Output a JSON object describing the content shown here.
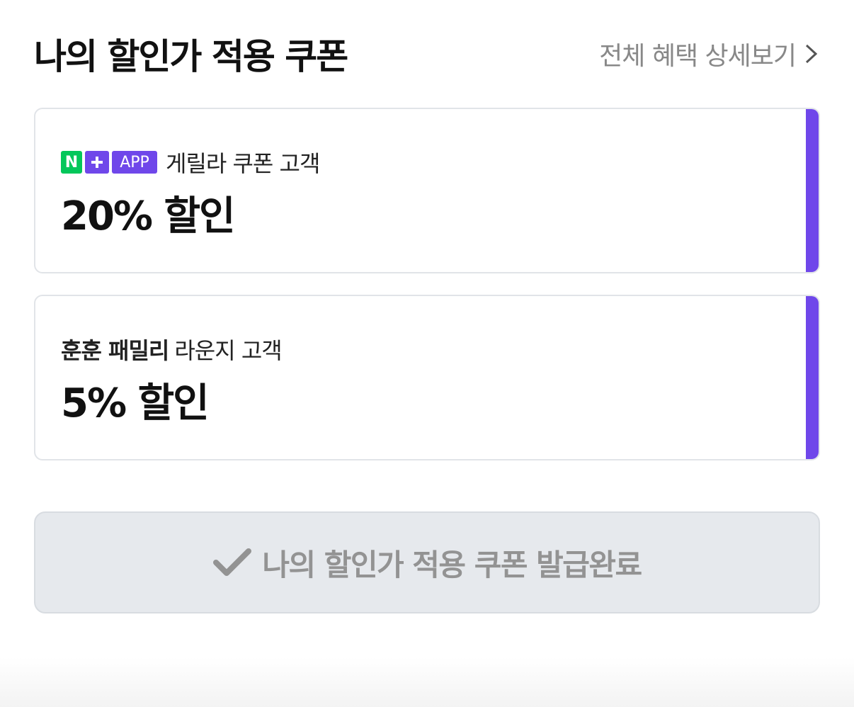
{
  "header": {
    "title": "나의 할인가 적용 쿠폰",
    "detail_link": "전체 혜택 상세보기",
    "detail_icon": "chevron-right-icon"
  },
  "coupons": [
    {
      "badges": {
        "n": "N",
        "plus_icon": "plus-icon",
        "app": "APP"
      },
      "label": "게릴라 쿠폰 고객",
      "value": "20% 할인",
      "accent_color": "#6f47ea"
    },
    {
      "label_bold": "훈훈 패밀리",
      "label": "라운지 고객",
      "value": "5% 할인",
      "accent_color": "#6f47ea"
    }
  ],
  "issued_button": {
    "icon": "check-icon",
    "label": "나의 할인가 적용 쿠폰 발급완료"
  },
  "colors": {
    "accent": "#6f47ea",
    "naver_green": "#03c75a",
    "disabled_bg": "#e6e9ed",
    "disabled_text": "#939393"
  }
}
